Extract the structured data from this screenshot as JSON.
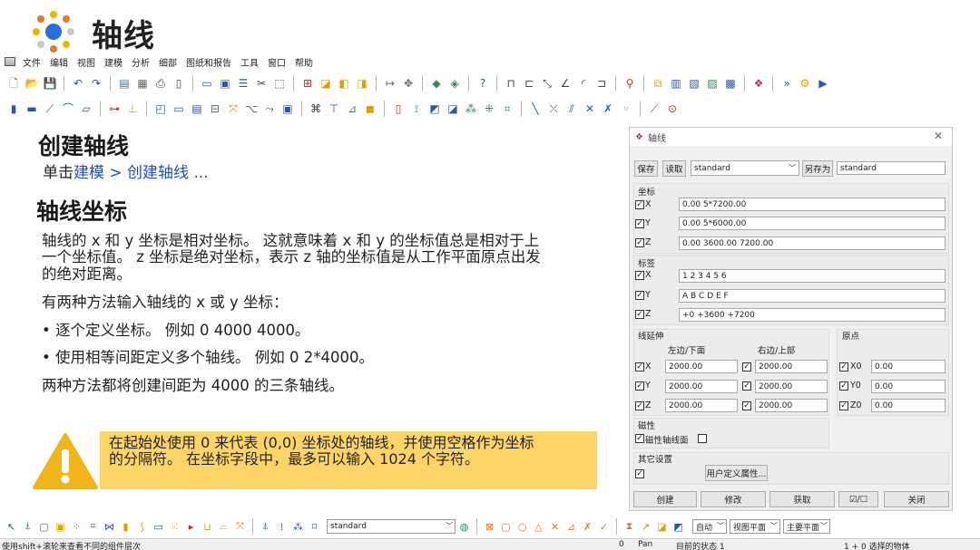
{
  "slide": {
    "title": "轴线",
    "section1_heading": "创建轴线",
    "nav_prefix": "单击",
    "nav_link": "建模 > 创建轴线 ...",
    "section2_heading": "轴线坐标",
    "para1_line1": "轴线的 x 和 y 坐标是相对坐标。 这就意味着 x 和 y 的坐标值总是相对于上",
    "para1_line2": "一个坐标值。  z 坐标是绝对坐标，表示 z 轴的坐标值是从工作平面原点出发",
    "para1_line3": "的绝对距离。",
    "para2": "有两种方法输入轴线的 x 或 y 坐标：",
    "bullet1": "• 逐个定义坐标。 例如 0 4000 4000。",
    "bullet2": "• 使用相等间距定义多个轴线。 例如 0 2*4000。",
    "para3": "两种方法都将创建间距为 4000 的三条轴线。",
    "warning_line1": "在起始处使用 0 来代表 (0,0) 坐标处的轴线，并使用空格作为坐标",
    "warning_line2": "的分隔符。 在坐标字段中，最多可以输入 1024 个字符。"
  },
  "menubar": [
    "文件",
    "编辑",
    "视图",
    "建模",
    "分析",
    "细部",
    "图纸和报告",
    "工具",
    "窗口",
    "帮助"
  ],
  "dialog": {
    "title": "轴线",
    "save": "保存",
    "load": "读取",
    "preset": "standard",
    "save_as": "另存为",
    "save_as_value": "standard",
    "coord_group": "坐标",
    "x_label": "X",
    "y_label": "Y",
    "z_label": "Z",
    "coord_x": "0.00 5*7200.00",
    "coord_y": "0.00 5*6000.00",
    "coord_z": "0.00 3600.00 7200.00",
    "label_group": "标签",
    "label_x": "1 2 3 4 5 6",
    "label_y": "A B C D E F",
    "label_z": "+0 +3600 +7200",
    "ext_group": "线延伸",
    "left_lower": "左边/下面",
    "right_upper": "右边/上部",
    "origin_group": "原点",
    "ext_x_left": "2000.00",
    "ext_x_right": "2000.00",
    "ext_y_left": "2000.00",
    "ext_y_right": "2000.00",
    "ext_z_left": "2000.00",
    "ext_z_right": "2000.00",
    "x0_label": "X0",
    "y0_label": "Y0",
    "z0_label": "Z0",
    "x0": "0.00",
    "y0": "0.00",
    "z0": "0.00",
    "magnet_group": "磁性",
    "magnet_plane": "磁性轴线面",
    "other_group": "其它设置",
    "udf_button": "用户定义属性...",
    "create": "创建",
    "modify": "修改",
    "get": "获取",
    "toggle": "☑/☐",
    "close": "关闭"
  },
  "bottom": {
    "preset": "standard",
    "auto": "自动",
    "view_plane": "视图平面",
    "main_part": "主要平面"
  },
  "status": {
    "hint": "使用shift+滚轮来查看不同的组件层次",
    "zero": "0",
    "pan": "Pan",
    "state": "目前的状态 1",
    "selected": "1 + 0 选择的物体"
  },
  "colors": {
    "accent": "#1f4fbf",
    "warning": "#fcd467",
    "warning_icon": "#f3b51c"
  }
}
